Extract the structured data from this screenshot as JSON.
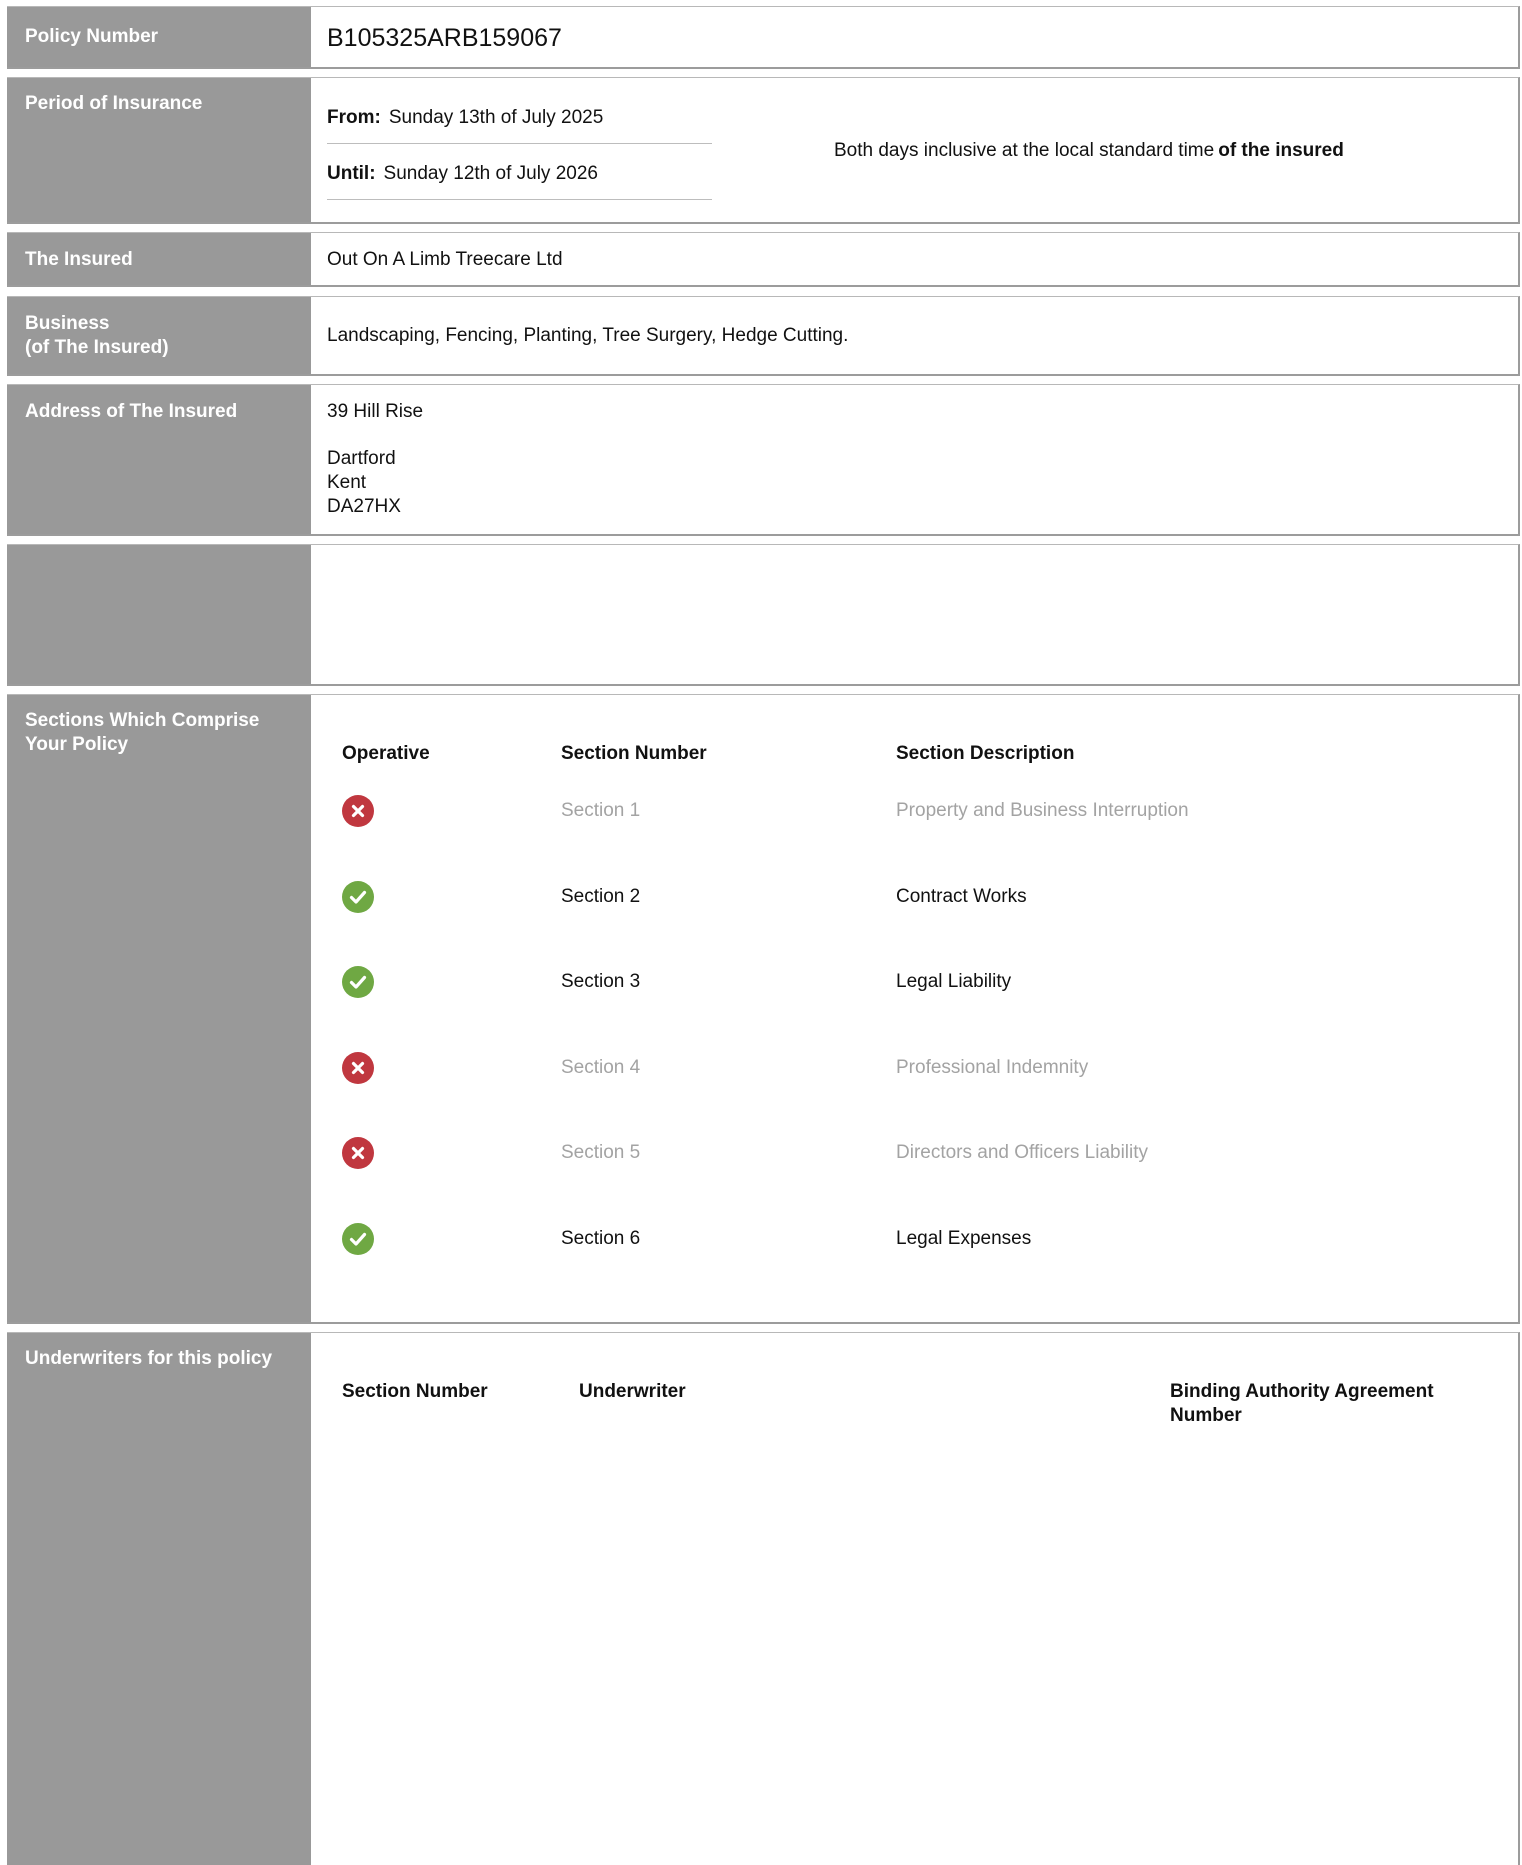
{
  "policy": {
    "label": "Policy Number",
    "value": "B105325ARB159067"
  },
  "period": {
    "label": "Period of Insurance",
    "from_label": "From:",
    "from_value": "Sunday 13th of July 2025",
    "until_label": "Until:",
    "until_value": "Sunday 12th of July 2026",
    "note_text": "Both days inclusive at the local standard time",
    "note_bold": "of the insured"
  },
  "insured": {
    "label": "The Insured",
    "value": "Out On A Limb Treecare Ltd"
  },
  "business": {
    "label_line1": "Business",
    "label_line2": "(of The Insured)",
    "value": "Landscaping, Fencing, Planting, Tree Surgery, Hedge Cutting."
  },
  "address": {
    "label": "Address of The Insured",
    "line1": "39 Hill Rise",
    "line2": "Dartford",
    "line3": "Kent",
    "line4": "DA27HX"
  },
  "sections": {
    "label": "Sections Which Comprise Your Policy",
    "headers": {
      "operative": "Operative",
      "number": "Section Number",
      "description": "Section Description"
    },
    "rows": [
      {
        "number": "Section 1",
        "description": "Property and Business Interruption",
        "operative": false
      },
      {
        "number": "Section 2",
        "description": "Contract Works",
        "operative": true
      },
      {
        "number": "Section 3",
        "description": "Legal Liability",
        "operative": true
      },
      {
        "number": "Section 4",
        "description": "Professional Indemnity",
        "operative": false
      },
      {
        "number": "Section 5",
        "description": "Directors and Officers Liability",
        "operative": false
      },
      {
        "number": "Section 6",
        "description": "Legal Expenses",
        "operative": true
      }
    ],
    "colors": {
      "operative": "#6fa843",
      "inoperative": "#c0373f"
    }
  },
  "underwriters": {
    "label": "Underwriters for this policy",
    "headers": {
      "number": "Section Number",
      "underwriter": "Underwriter",
      "baa_line1": "Binding Authority Agreement",
      "baa_line2": "Number"
    }
  }
}
